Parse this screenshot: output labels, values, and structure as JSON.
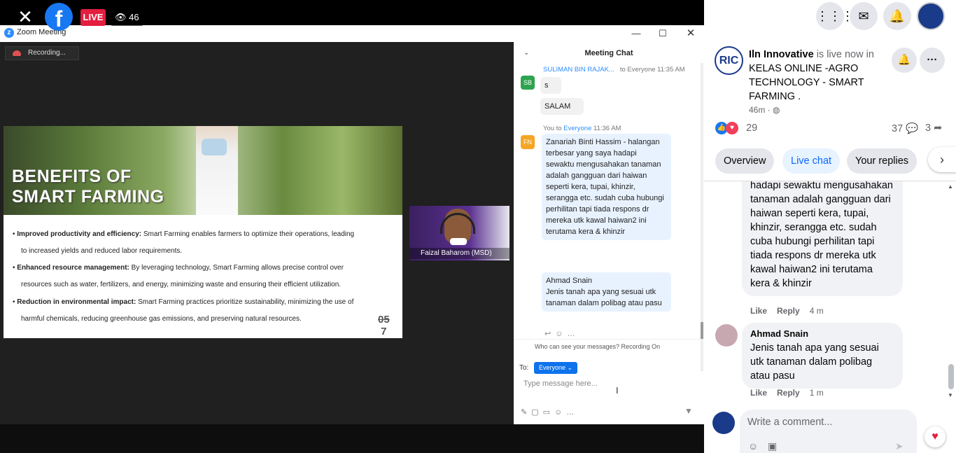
{
  "overlay": {
    "close_icon": "close-icon",
    "fb_logo": "f",
    "live_label": "LIVE",
    "viewer_count": "46"
  },
  "zoom": {
    "title": "Zoom Meeting",
    "recording_label": "Recording...",
    "slide": {
      "title_line1": "BENEFITS OF",
      "title_line2": "SMART FARMING",
      "bullets": [
        {
          "bold": "Improved productivity and efficiency:",
          "text": " Smart Farming enables farmers to optimize their operations, leading",
          "cont": "to increased yields and reduced labor requirements."
        },
        {
          "bold": "Enhanced resource management:",
          "text": " By leveraging technology, Smart Farming allows precise control over",
          "cont": "resources such as water, fertilizers, and energy, minimizing waste and ensuring their efficient utilization."
        },
        {
          "bold": "Reduction in environmental impact:",
          "text": " Smart Farming practices prioritize sustainability, minimizing the use of",
          "cont": "harmful chemicals, reducing greenhouse gas emissions, and preserving natural resources."
        }
      ],
      "page_number_top": "05",
      "page_number_bottom": "7"
    },
    "participant_name": "Faizal Baharom (MSD)",
    "chat": {
      "header": "Meeting Chat",
      "msg1": {
        "avatar": "SB",
        "sender": "SULIMAN BIN RAJAK...",
        "to": "to Everyone",
        "time": "11:35 AM",
        "text1": "s",
        "text2": "SALAM"
      },
      "msg2": {
        "avatar": "FN",
        "sender": "You to",
        "to": "Everyone",
        "time": "11:36 AM",
        "text1": "Zanariah Binti Hassim - halangan terbesar yang saya hadapi sewaktu mengusahakan tanaman adalah gangguan dari haiwan seperti kera, tupai, khinzir, serangga etc. sudah cuba hubungi perhilitan tapi tiada respons dr mereka utk kawal haiwan2 ini terutama kera & khinzir",
        "text2": "Ahmad Snain\nJenis tanah apa yang sesuai utk tanaman dalam polibag atau pasu"
      },
      "who_can_see": "Who can see your messages? Recording On",
      "to_label": "To:",
      "to_value": "Everyone ⌄",
      "placeholder": "Type message here..."
    }
  },
  "facebook": {
    "page_name": "Iln Innovative",
    "live_text": " is live now in ",
    "group_name": "KELAS ONLINE -AGRO TECHNOLOGY - SMART FARMING",
    "group_suffix": " .",
    "time_ago": "46m ·",
    "avatar_text": "RIC",
    "reaction_count": "29",
    "comment_count": "37",
    "share_count": "3",
    "tabs": [
      "Overview",
      "Live chat",
      "Your replies"
    ],
    "comments": [
      {
        "name": "",
        "text": "hadapi sewaktu mengusahakan tanaman adalah gangguan dari haiwan seperti kera, tupai, khinzir, serangga etc. sudah cuba hubungi perhilitan tapi tiada respons dr mereka utk kawal haiwan2 ini terutama kera & khinzir",
        "like": "Like",
        "reply": "Reply",
        "time": "4 m"
      },
      {
        "name": "Ahmad Snain",
        "text": "Jenis tanah apa yang sesuai utk tanaman dalam polibag atau pasu",
        "like": "Like",
        "reply": "Reply",
        "time": "1 m"
      }
    ],
    "write_placeholder": "Write a comment...",
    "colors": {
      "fb_blue": "#1877f2",
      "live_red": "#e41e3f",
      "zoom_blue": "#2d8cff"
    }
  }
}
